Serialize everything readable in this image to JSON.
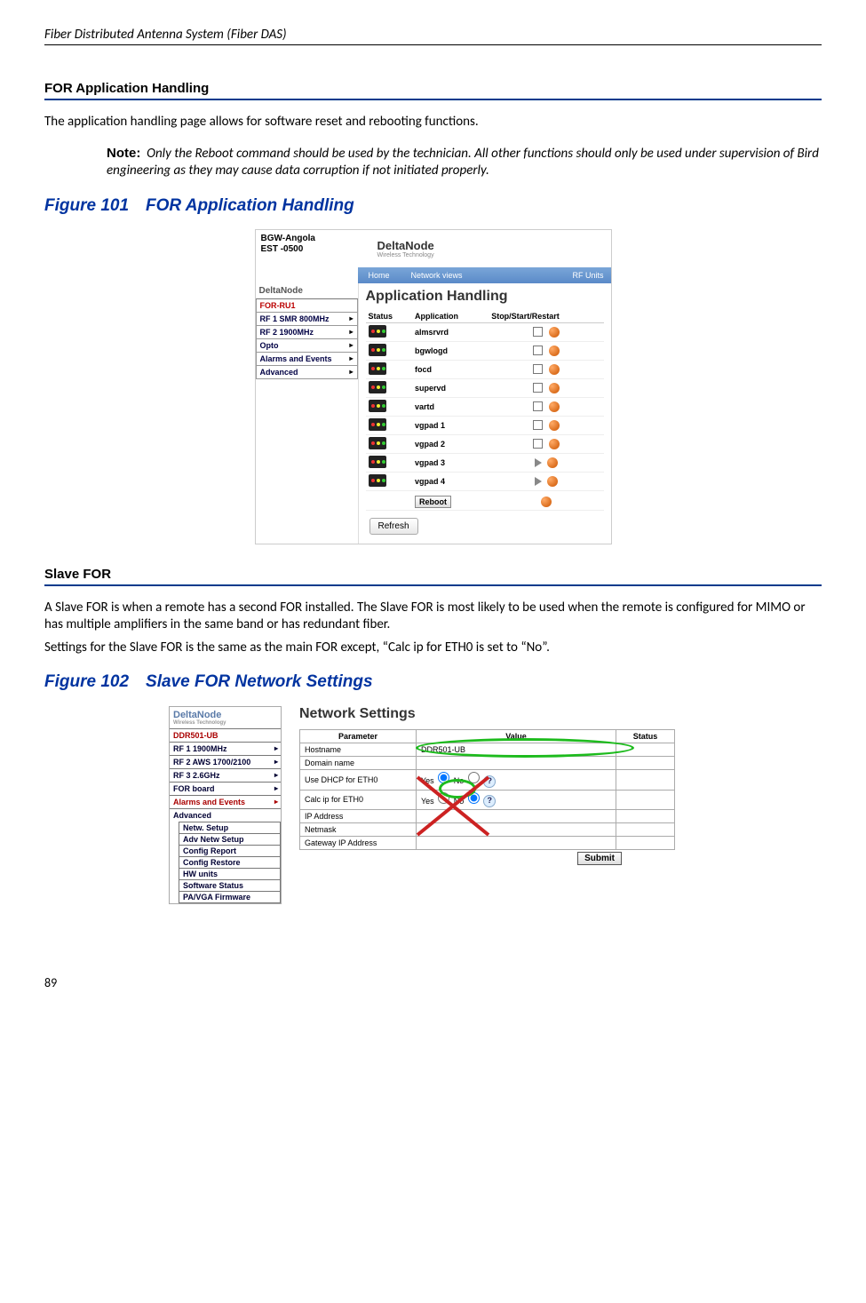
{
  "header_title": "Fiber Distributed Antenna System (Fiber DAS)",
  "page_number": "89",
  "section1": {
    "heading": "FOR Application Handling",
    "intro": "The application handling page allows for software reset and rebooting functions.",
    "note_label": "Note:",
    "note_text": "Only the Reboot command should be used by the technician. All other functions should only be used under supervision of Bird engineering as they may cause data corruption if not initiated properly."
  },
  "figure101": {
    "caption": "Figure 101 FOR Application Handling",
    "top_left_line1": "BGW-Angola",
    "top_left_line2": "EST -0500",
    "logo": "DeltaNode",
    "logo_sub": "Wireless  Technology",
    "nav": {
      "home": "Home",
      "network": "Network views",
      "rf": "RF Units"
    },
    "sidebar_logo": "DeltaNode",
    "sidebar": [
      {
        "label": "FOR-RU1",
        "color": "red",
        "arrow": false
      },
      {
        "label": "RF 1 SMR 800MHz",
        "color": "blue",
        "arrow": true
      },
      {
        "label": "RF 2 1900MHz",
        "color": "blue",
        "arrow": true
      },
      {
        "label": "Opto",
        "color": "blue",
        "arrow": true
      },
      {
        "label": "Alarms and Events",
        "color": "blue",
        "arrow": true
      },
      {
        "label": "Advanced",
        "color": "blue",
        "arrow": true
      }
    ],
    "main_heading": "Application Handling",
    "columns": {
      "status": "Status",
      "app": "Application",
      "ss": "Stop/Start/Restart"
    },
    "rows": [
      {
        "app": "almsrvrd",
        "ctl": "stop"
      },
      {
        "app": "bgwlogd",
        "ctl": "stop"
      },
      {
        "app": "focd",
        "ctl": "stop"
      },
      {
        "app": "supervd",
        "ctl": "stop"
      },
      {
        "app": "vartd",
        "ctl": "stop"
      },
      {
        "app": "vgpad 1",
        "ctl": "stop"
      },
      {
        "app": "vgpad 2",
        "ctl": "stop"
      },
      {
        "app": "vgpad 3",
        "ctl": "start"
      },
      {
        "app": "vgpad 4",
        "ctl": "start"
      }
    ],
    "reboot": "Reboot",
    "refresh": "Refresh"
  },
  "section2": {
    "heading": "Slave FOR",
    "p1": "A Slave FOR is when a remote has a second FOR installed. The Slave FOR is most likely to be used when the remote is configured for MIMO or has multiple amplifiers in the same band or has redundant fiber.",
    "p2": "Settings for the Slave FOR is the same as the main FOR except, “Calc ip for ETH0 is set to “No”."
  },
  "figure102": {
    "caption": "Figure 102 Slave FOR Network Settings",
    "logo": "DeltaNode",
    "logo_sub": "Wireless   Technology",
    "sidebar": [
      {
        "label": "DDR501-UB",
        "color": "red"
      },
      {
        "label": "RF 1 1900MHz",
        "color": "blue",
        "arrow": true
      },
      {
        "label": "RF 2 AWS 1700/2100",
        "color": "blue",
        "arrow": true
      },
      {
        "label": "RF 3 2.6GHz",
        "color": "blue",
        "arrow": true
      },
      {
        "label": "FOR board",
        "color": "blue",
        "arrow": true
      },
      {
        "label": "Alarms and Events",
        "color": "red",
        "arrow": true
      },
      {
        "label": "Advanced",
        "color": "blue",
        "arrow": false
      }
    ],
    "submenu": [
      "Netw. Setup",
      "Adv Netw Setup",
      "Config Report",
      "Config Restore",
      "HW units",
      "Software Status",
      "PA/VGA Firmware"
    ],
    "main_heading": "Network Settings",
    "columns": {
      "param": "Parameter",
      "value": "Value",
      "status": "Status"
    },
    "rows": [
      {
        "param": "Hostname",
        "value": "DDR501-UB"
      },
      {
        "param": "Domain name",
        "value": ""
      },
      {
        "param": "Use DHCP for ETH0",
        "value_yes": "Yes",
        "value_no": "No",
        "sel": "yes"
      },
      {
        "param": "Calc ip for ETH0",
        "value_yes": "Yes",
        "value_no": "No",
        "sel": "no"
      },
      {
        "param": "IP Address",
        "value": ""
      },
      {
        "param": "Netmask",
        "value": ""
      },
      {
        "param": "Gateway IP Address",
        "value": ""
      }
    ],
    "submit": "Submit",
    "qmark": "?"
  }
}
